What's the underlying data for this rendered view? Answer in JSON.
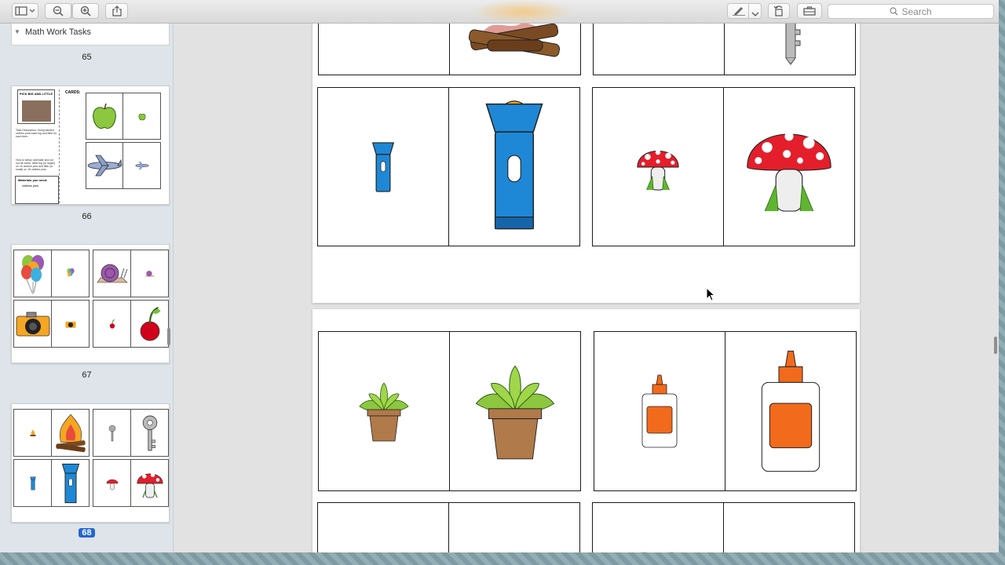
{
  "toolbar": {
    "search_placeholder": "Search",
    "icons": [
      "sidebar-toggle-icon",
      "zoom-out-icon",
      "zoom-in-icon",
      "share-icon",
      "markup-icon",
      "rotate-icon",
      "toolbox-icon",
      "search-icon"
    ]
  },
  "sidebar": {
    "header_title": "Math Work Tasks",
    "pages": [
      {
        "number": "65"
      },
      {
        "number": "66",
        "thumb_title": "PICK BIG AND LITTLE",
        "thumb_cards_label": "CARDS:",
        "thumb_desc": "Task Description: Using labeled clothes pins mark big and little for each item.",
        "thumb_setup": "How to setup: laminate and cut out all cards, write big (or larger) on 16 clothes pins and little (or small) on 16 clothes pins.",
        "thumb_materials": "Materials you need:",
        "thumb_materials_item": "clothes pins"
      },
      {
        "number": "67"
      },
      {
        "number": "68",
        "selected": true
      }
    ]
  },
  "colors": {
    "selection": "#2267d0",
    "flashlight": "#1e88d6",
    "mushroom": "#e41e2b",
    "plant": "#8dc63f",
    "pot": "#b07a4a",
    "glue": "#f26a1b"
  }
}
